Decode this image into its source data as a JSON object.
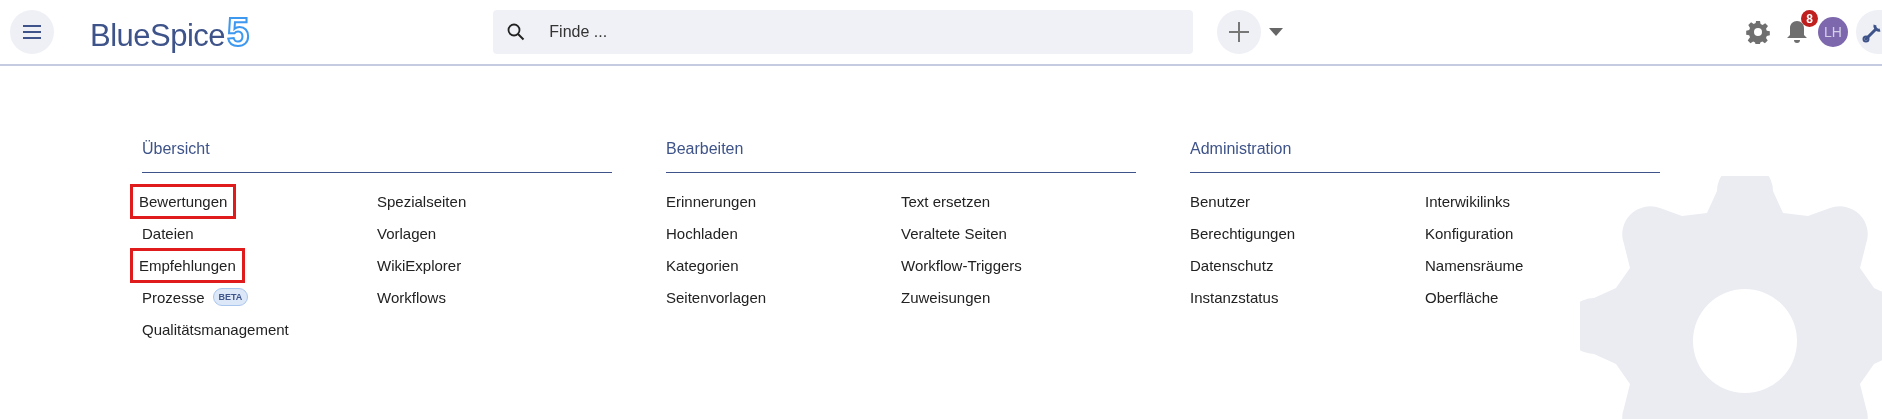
{
  "header": {
    "logo": {
      "name": "BlueSpice",
      "version": "5"
    },
    "search": {
      "placeholder": "Finde ..."
    },
    "notifications": {
      "count": "8"
    },
    "avatar": {
      "initials": "LH"
    }
  },
  "sections": [
    {
      "title": "Übersicht",
      "columns": [
        [
          {
            "label": "Bewertungen",
            "highlighted": true
          },
          {
            "label": "Dateien",
            "highlighted": false
          },
          {
            "label": "Empfehlungen",
            "highlighted": true
          },
          {
            "label": "Prozesse",
            "highlighted": false,
            "badge": "BETA"
          },
          {
            "label": "Qualitätsmanagement",
            "highlighted": false
          }
        ],
        [
          {
            "label": "Spezialseiten",
            "highlighted": false
          },
          {
            "label": "Vorlagen",
            "highlighted": false
          },
          {
            "label": "WikiExplorer",
            "highlighted": false
          },
          {
            "label": "Workflows",
            "highlighted": false
          }
        ]
      ]
    },
    {
      "title": "Bearbeiten",
      "columns": [
        [
          {
            "label": "Erinnerungen",
            "highlighted": false
          },
          {
            "label": "Hochladen",
            "highlighted": false
          },
          {
            "label": "Kategorien",
            "highlighted": false
          },
          {
            "label": "Seitenvorlagen",
            "highlighted": false
          }
        ],
        [
          {
            "label": "Text ersetzen",
            "highlighted": false
          },
          {
            "label": "Veraltete Seiten",
            "highlighted": false
          },
          {
            "label": "Workflow-Triggers",
            "highlighted": false
          },
          {
            "label": "Zuweisungen",
            "highlighted": false
          }
        ]
      ]
    },
    {
      "title": "Administration",
      "columns": [
        [
          {
            "label": "Benutzer",
            "highlighted": false
          },
          {
            "label": "Berechtigungen",
            "highlighted": false
          },
          {
            "label": "Datenschutz",
            "highlighted": false
          },
          {
            "label": "Instanzstatus",
            "highlighted": false
          }
        ],
        [
          {
            "label": "Interwikilinks",
            "highlighted": false
          },
          {
            "label": "Konfiguration",
            "highlighted": false
          },
          {
            "label": "Namensräume",
            "highlighted": false
          },
          {
            "label": "Oberfläche",
            "highlighted": false
          }
        ]
      ]
    }
  ]
}
